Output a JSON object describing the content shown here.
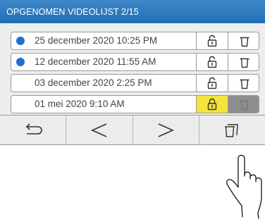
{
  "header": {
    "title": "OPGENOMEN VIDEOLIJST 2/15"
  },
  "recordings": [
    {
      "label": "25 december 2020 10:25 PM",
      "unseen": true,
      "locked": false
    },
    {
      "label": "12 december 2020 11:55 AM",
      "unseen": true,
      "locked": false
    },
    {
      "label": "03 december 2020 2:25 PM",
      "unseen": false,
      "locked": false
    },
    {
      "label": "01 mei 2020 9:10 AM",
      "unseen": false,
      "locked": true
    }
  ],
  "toolbar": {
    "buttons": [
      "back-icon",
      "previous-icon",
      "next-icon",
      "delete-all-icon"
    ]
  },
  "colors": {
    "titlebar": "#2a78be",
    "unseen_dot": "#1f6fd0",
    "lock_active": "#f4e33a",
    "delete_disabled": "#8e8e8e"
  }
}
